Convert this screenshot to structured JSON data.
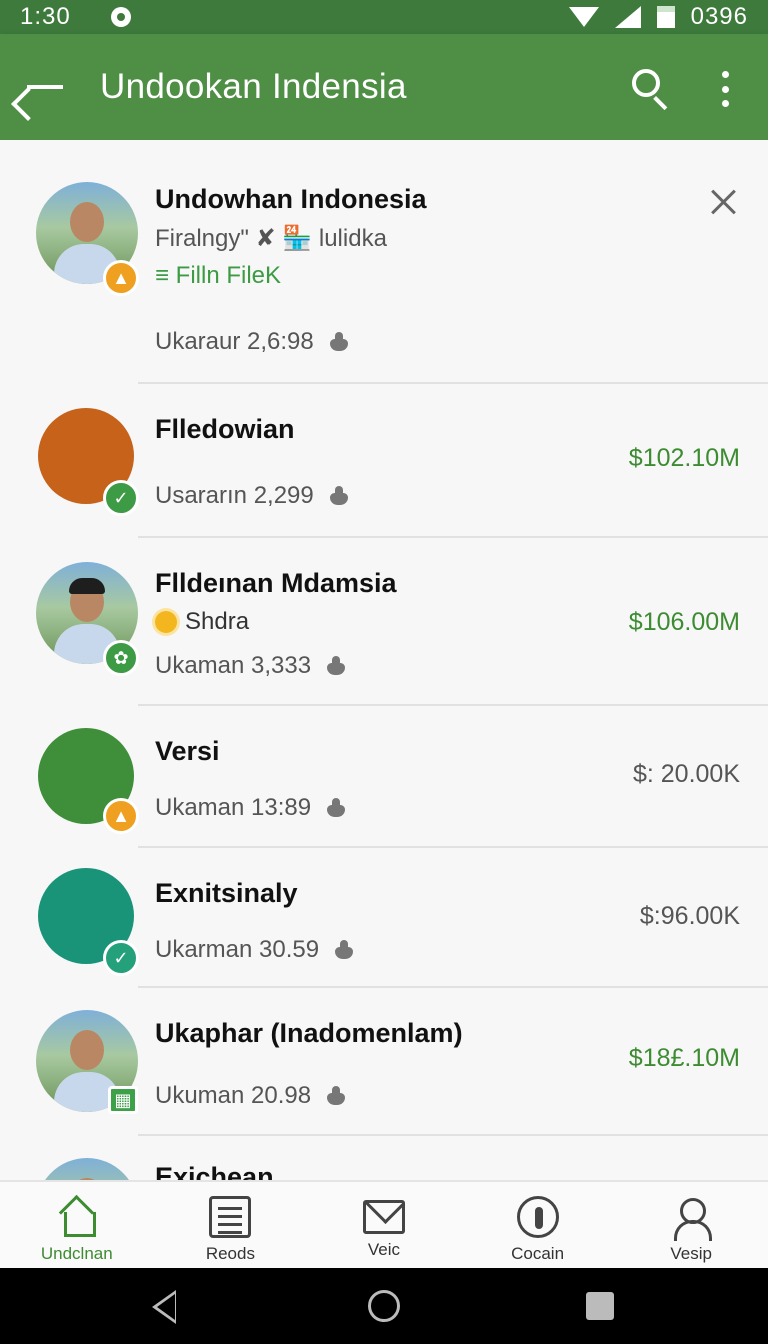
{
  "status_bar": {
    "time": "1:30",
    "battery": "0396"
  },
  "app_bar": {
    "title": "Undookan Indensia"
  },
  "items": [
    {
      "name": "Undowhan Indonesia",
      "sub1": "Firalngy\" ✘ 🏪 lulidka",
      "sub2": "≡ Filln FileK",
      "subscribers": "Ukaraur 2,6:98"
    },
    {
      "name": "Flledowian",
      "subscribers": "Usararın 2,299",
      "price": "$102.10M"
    },
    {
      "name": "Flldeınan Mdamsia",
      "sub1": "Shdra",
      "subscribers": "Ukaman 3,333",
      "price": "$106.00M"
    },
    {
      "name": "Versi",
      "subscribers": "Ukaman 13:89",
      "price": "$: 20.00K"
    },
    {
      "name": "Exnitsinaly",
      "subscribers": "Ukarman 30.59",
      "price": "$:96.00K"
    },
    {
      "name": "Ukaphar (Inadomenlam)",
      "subscribers": "Ukuman 20.98",
      "price": "$18£.10M"
    },
    {
      "name": "Exichean"
    }
  ],
  "bottom_nav": [
    {
      "label": "Undclnan"
    },
    {
      "label": "Reods"
    },
    {
      "label": "Veic"
    },
    {
      "label": "Cocain"
    },
    {
      "label": "Vesip"
    }
  ],
  "icons": {
    "accent": "#4f8f45",
    "price_green": "#3d8c32"
  }
}
